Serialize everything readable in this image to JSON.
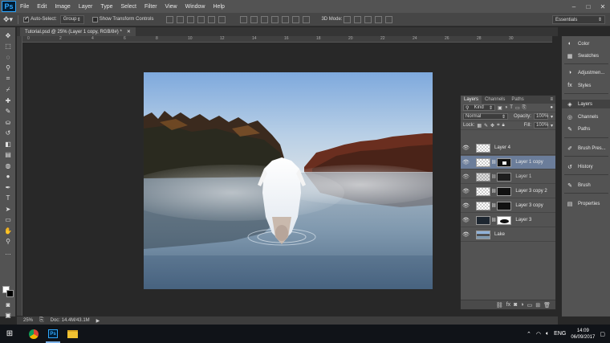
{
  "app": {
    "logo": "Ps"
  },
  "menu": [
    "File",
    "Edit",
    "Image",
    "Layer",
    "Type",
    "Select",
    "Filter",
    "View",
    "Window",
    "Help"
  ],
  "window_controls": [
    "–",
    "□",
    "✕"
  ],
  "options_bar": {
    "auto_select_label": "Auto-Select:",
    "auto_select_value": "Group",
    "show_transform_label": "Show Transform Controls",
    "mode_3d_label": "3D Mode:",
    "workspace": "Essentials"
  },
  "document": {
    "tab_title": "Tutorial.psd @ 25% (Layer 1 copy, RGB/8#) *",
    "zoom": "25%",
    "doc_info": "Doc: 14.4M/43.1M"
  },
  "ruler_ticks": [
    "0",
    "2",
    "4",
    "6",
    "8",
    "10",
    "12",
    "14",
    "16",
    "18",
    "20",
    "22",
    "24",
    "26",
    "28",
    "30"
  ],
  "layers_panel": {
    "tabs": [
      "Layers",
      "Channels",
      "Paths"
    ],
    "kind_label": "Kind",
    "blend_mode": "Normal",
    "opacity_label": "Opacity:",
    "opacity_value": "100%",
    "lock_label": "Lock:",
    "fill_label": "Fill:",
    "fill_value": "100%",
    "layers": [
      {
        "name": "Layer 4",
        "selected": false,
        "has_mask": false
      },
      {
        "name": "Layer 1 copy",
        "selected": true,
        "has_mask": true
      },
      {
        "name": "Layer 1",
        "selected": false,
        "has_mask": true
      },
      {
        "name": "Layer 3 copy 2",
        "selected": false,
        "has_mask": true
      },
      {
        "name": "Layer 3 copy",
        "selected": false,
        "has_mask": true
      },
      {
        "name": "Layer 3",
        "selected": false,
        "has_mask": true
      },
      {
        "name": "Lake",
        "selected": false,
        "has_mask": false
      }
    ],
    "footer_icons": [
      "link-icon",
      "fx-icon",
      "mask-icon",
      "adjustment-icon",
      "group-icon",
      "new-layer-icon",
      "trash-icon"
    ]
  },
  "dock_panels": [
    {
      "label": "Color",
      "icon": "color-icon"
    },
    {
      "label": "Swatches",
      "icon": "swatches-icon"
    },
    {
      "label": "Adjustmen...",
      "icon": "adjustments-icon"
    },
    {
      "label": "Styles",
      "icon": "styles-icon"
    },
    {
      "label": "Layers",
      "icon": "layers-icon"
    },
    {
      "label": "Channels",
      "icon": "channels-icon"
    },
    {
      "label": "Paths",
      "icon": "paths-icon"
    },
    {
      "label": "Brush Pres...",
      "icon": "brush-presets-icon"
    },
    {
      "label": "History",
      "icon": "history-icon"
    },
    {
      "label": "Brush",
      "icon": "brush-icon"
    },
    {
      "label": "Properties",
      "icon": "properties-icon"
    }
  ],
  "taskbar": {
    "lang": "ENG",
    "time": "14:09",
    "date": "06/09/2017"
  },
  "colors": {
    "panel": "#535353",
    "workspace_bg": "#282828",
    "selected_layer": "#6b7d9a",
    "ps_blue": "#31a8ff"
  }
}
